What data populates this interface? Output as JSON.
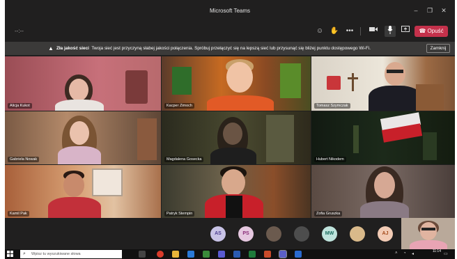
{
  "window": {
    "title": "Microsoft Teams"
  },
  "toolbar": {
    "timer": "--:--",
    "leave_label": "Opuść"
  },
  "banner": {
    "title": "Zła jakość sieci",
    "message": "Twoja sieć jest przyczyną słabej jakości połączenia. Spróbuj przełączyć się na lepszą sieć lub przysunąć się bliżej punktu dostępowego Wi-Fi.",
    "close_label": "Zamknij"
  },
  "participants": [
    {
      "name": "Alicja Kukot"
    },
    {
      "name": "Kacper Zimoch"
    },
    {
      "name": "Tomasz Szymczak"
    },
    {
      "name": "Gabriela Nowak"
    },
    {
      "name": "Magdalena Gosecka"
    },
    {
      "name": "Hubert Nikodem"
    },
    {
      "name": "Kamil Pak"
    },
    {
      "name": "Patryk Stempin"
    },
    {
      "name": "Zofia Gruszka"
    }
  ],
  "roster": [
    {
      "initials": "AS",
      "color": "#c8c3e6",
      "text": "#4b3d8f"
    },
    {
      "initials": "PS",
      "color": "#e6c8e0",
      "text": "#8a2d78"
    },
    {
      "initials": "",
      "color": "#6b5a4e",
      "text": "#fff"
    },
    {
      "initials": "",
      "color": "#4d4d4d",
      "text": "#fff"
    },
    {
      "initials": "MW",
      "color": "#bfe3dc",
      "text": "#1b6d5f"
    },
    {
      "initials": "",
      "color": "#d9b98a",
      "text": "#fff"
    },
    {
      "initials": "AJ",
      "color": "#f2cbb5",
      "text": "#a34a1b"
    }
  ],
  "taskbar": {
    "search_placeholder": "Wpisz tu wyszukiwane słowa",
    "time": "11:14"
  }
}
